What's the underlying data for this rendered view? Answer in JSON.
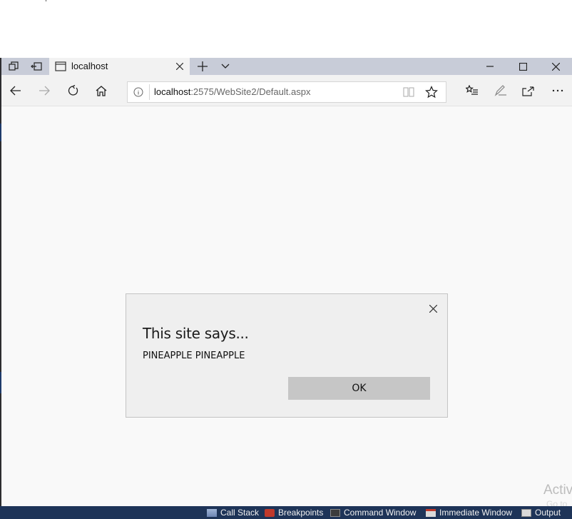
{
  "browser": {
    "tab": {
      "title": "localhost"
    },
    "address": {
      "host": "localhost",
      "path": ":2575/WebSite2/Default.aspx"
    }
  },
  "dialog": {
    "title": "This site says...",
    "message": "PINEAPPLE PINEAPPLE",
    "ok_label": "OK"
  },
  "watermark": {
    "line1": "Activ",
    "line2": "Go to"
  },
  "vs_toolbar": {
    "items": [
      {
        "label": "Call Stack",
        "icon": "call-stack-icon"
      },
      {
        "label": "Breakpoints",
        "icon": "breakpoints-icon"
      },
      {
        "label": "Command Window",
        "icon": "command-window-icon"
      },
      {
        "label": "Immediate Window",
        "icon": "immediate-window-icon"
      },
      {
        "label": "Output",
        "icon": "output-icon"
      }
    ]
  },
  "colors": {
    "tabbar_bg": "#c8ccd8",
    "toolbar_bg": "#f2f2f2",
    "dialog_bg": "#efefef",
    "ok_button_bg": "#c6c6c6",
    "vs_bar_bg": "#1e3458"
  }
}
